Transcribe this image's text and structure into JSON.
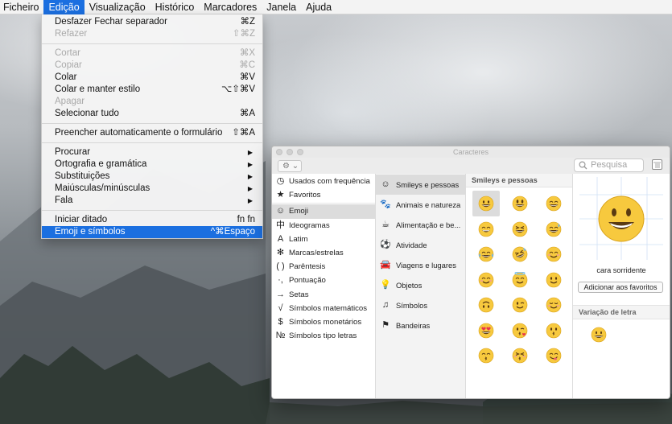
{
  "menubar": {
    "items": [
      {
        "label": "Ficheiro"
      },
      {
        "label": "Edição"
      },
      {
        "label": "Visualização"
      },
      {
        "label": "Histórico"
      },
      {
        "label": "Marcadores"
      },
      {
        "label": "Janela"
      },
      {
        "label": "Ajuda"
      }
    ]
  },
  "edit_menu": {
    "items": [
      {
        "label": "Desfazer Fechar separador",
        "shortcut": "⌘Z"
      },
      {
        "label": "Refazer",
        "shortcut": "⇧⌘Z"
      },
      {
        "label": "Cortar",
        "shortcut": "⌘X"
      },
      {
        "label": "Copiar",
        "shortcut": "⌘C"
      },
      {
        "label": "Colar",
        "shortcut": "⌘V"
      },
      {
        "label": "Colar e manter estilo",
        "shortcut": "⌥⇧⌘V"
      },
      {
        "label": "Apagar",
        "shortcut": ""
      },
      {
        "label": "Selecionar tudo",
        "shortcut": "⌘A"
      },
      {
        "label": "Preencher automaticamente o formulário",
        "shortcut": "⇧⌘A"
      },
      {
        "label": "Procurar",
        "shortcut": "▶"
      },
      {
        "label": "Ortografia e gramática",
        "shortcut": "▶"
      },
      {
        "label": "Substituições",
        "shortcut": "▶"
      },
      {
        "label": "Maiúsculas/minúsculas",
        "shortcut": "▶"
      },
      {
        "label": "Fala",
        "shortcut": "▶"
      },
      {
        "label": "Iniciar ditado",
        "shortcut": "fn fn"
      },
      {
        "label": "Emoji e símbolos",
        "shortcut": "^⌘Espaço"
      }
    ]
  },
  "char_window": {
    "title": "Caracteres",
    "gear": "⚙ ⌄",
    "search_placeholder": "Pesquisa",
    "left_items": [
      {
        "icon": "clock-icon",
        "glyph": "◷",
        "label": "Usados com frequência"
      },
      {
        "icon": "star-icon",
        "glyph": "★",
        "label": "Favoritos"
      },
      {
        "icon": "smiley-outline-icon",
        "glyph": "☺",
        "label": "Emoji"
      },
      {
        "icon": "ideogram-icon",
        "glyph": "中",
        "label": "Ideogramas"
      },
      {
        "icon": "latin-a-icon",
        "glyph": "A",
        "label": "Latim"
      },
      {
        "icon": "asterisk-icon",
        "glyph": "✻",
        "label": "Marcas/estrelas"
      },
      {
        "icon": "parentheses-icon",
        "glyph": "( )",
        "label": "Parêntesis"
      },
      {
        "icon": "punctuation-icon",
        "glyph": "·,",
        "label": "Pontuação"
      },
      {
        "icon": "arrow-right-icon",
        "glyph": "→",
        "label": "Setas"
      },
      {
        "icon": "sqrt-icon",
        "glyph": "√",
        "label": "Símbolos matemáticos"
      },
      {
        "icon": "dollar-icon",
        "glyph": "$",
        "label": "Símbolos monetários"
      },
      {
        "icon": "numero-icon",
        "glyph": "№",
        "label": "Símbolos tipo letras"
      }
    ],
    "categories": [
      {
        "icon": "smiley-icon",
        "glyph": "☺",
        "label": "Smileys e pessoas"
      },
      {
        "icon": "paw-icon",
        "glyph": "🐾",
        "label": "Animais e natureza"
      },
      {
        "icon": "cup-icon",
        "glyph": "☕",
        "label": "Alimentação e be..."
      },
      {
        "icon": "ball-icon",
        "glyph": "⚽",
        "label": "Atividade"
      },
      {
        "icon": "car-icon",
        "glyph": "🚘",
        "label": "Viagens e lugares"
      },
      {
        "icon": "bulb-icon",
        "glyph": "💡",
        "label": "Objetos"
      },
      {
        "icon": "symbols-icon",
        "glyph": "♫",
        "label": "Símbolos"
      },
      {
        "icon": "flag-icon",
        "glyph": "⚑",
        "label": "Bandeiras"
      }
    ],
    "grid_header": "Smileys e pessoas",
    "emoji_grid": [
      "grinning-face",
      "grinning-face-big-eyes",
      "grinning-squinting",
      "grinning-smiling-eyes",
      "laughing-squint",
      "sweat-smile",
      "tears-of-joy",
      "rolling-laughing",
      "smiling-blush",
      "smiling-face",
      "halo-face",
      "slightly-smiling",
      "upside-down-face",
      "winking-face",
      "relieved-face",
      "heart-eyes",
      "kissing-heart",
      "kissing-face",
      "kissing-smiling-eyes",
      "kissing-closed-eyes",
      "yum-face"
    ],
    "preview": {
      "name": "cara sorridente",
      "add_favorites": "Adicionar aos favoritos",
      "variation_header": "Variação de letra"
    }
  },
  "colors": {
    "menu_highlight": "#1b6fe0",
    "emoji_yellow": "#f7c93e",
    "emoji_outline": "#d9a21a"
  }
}
